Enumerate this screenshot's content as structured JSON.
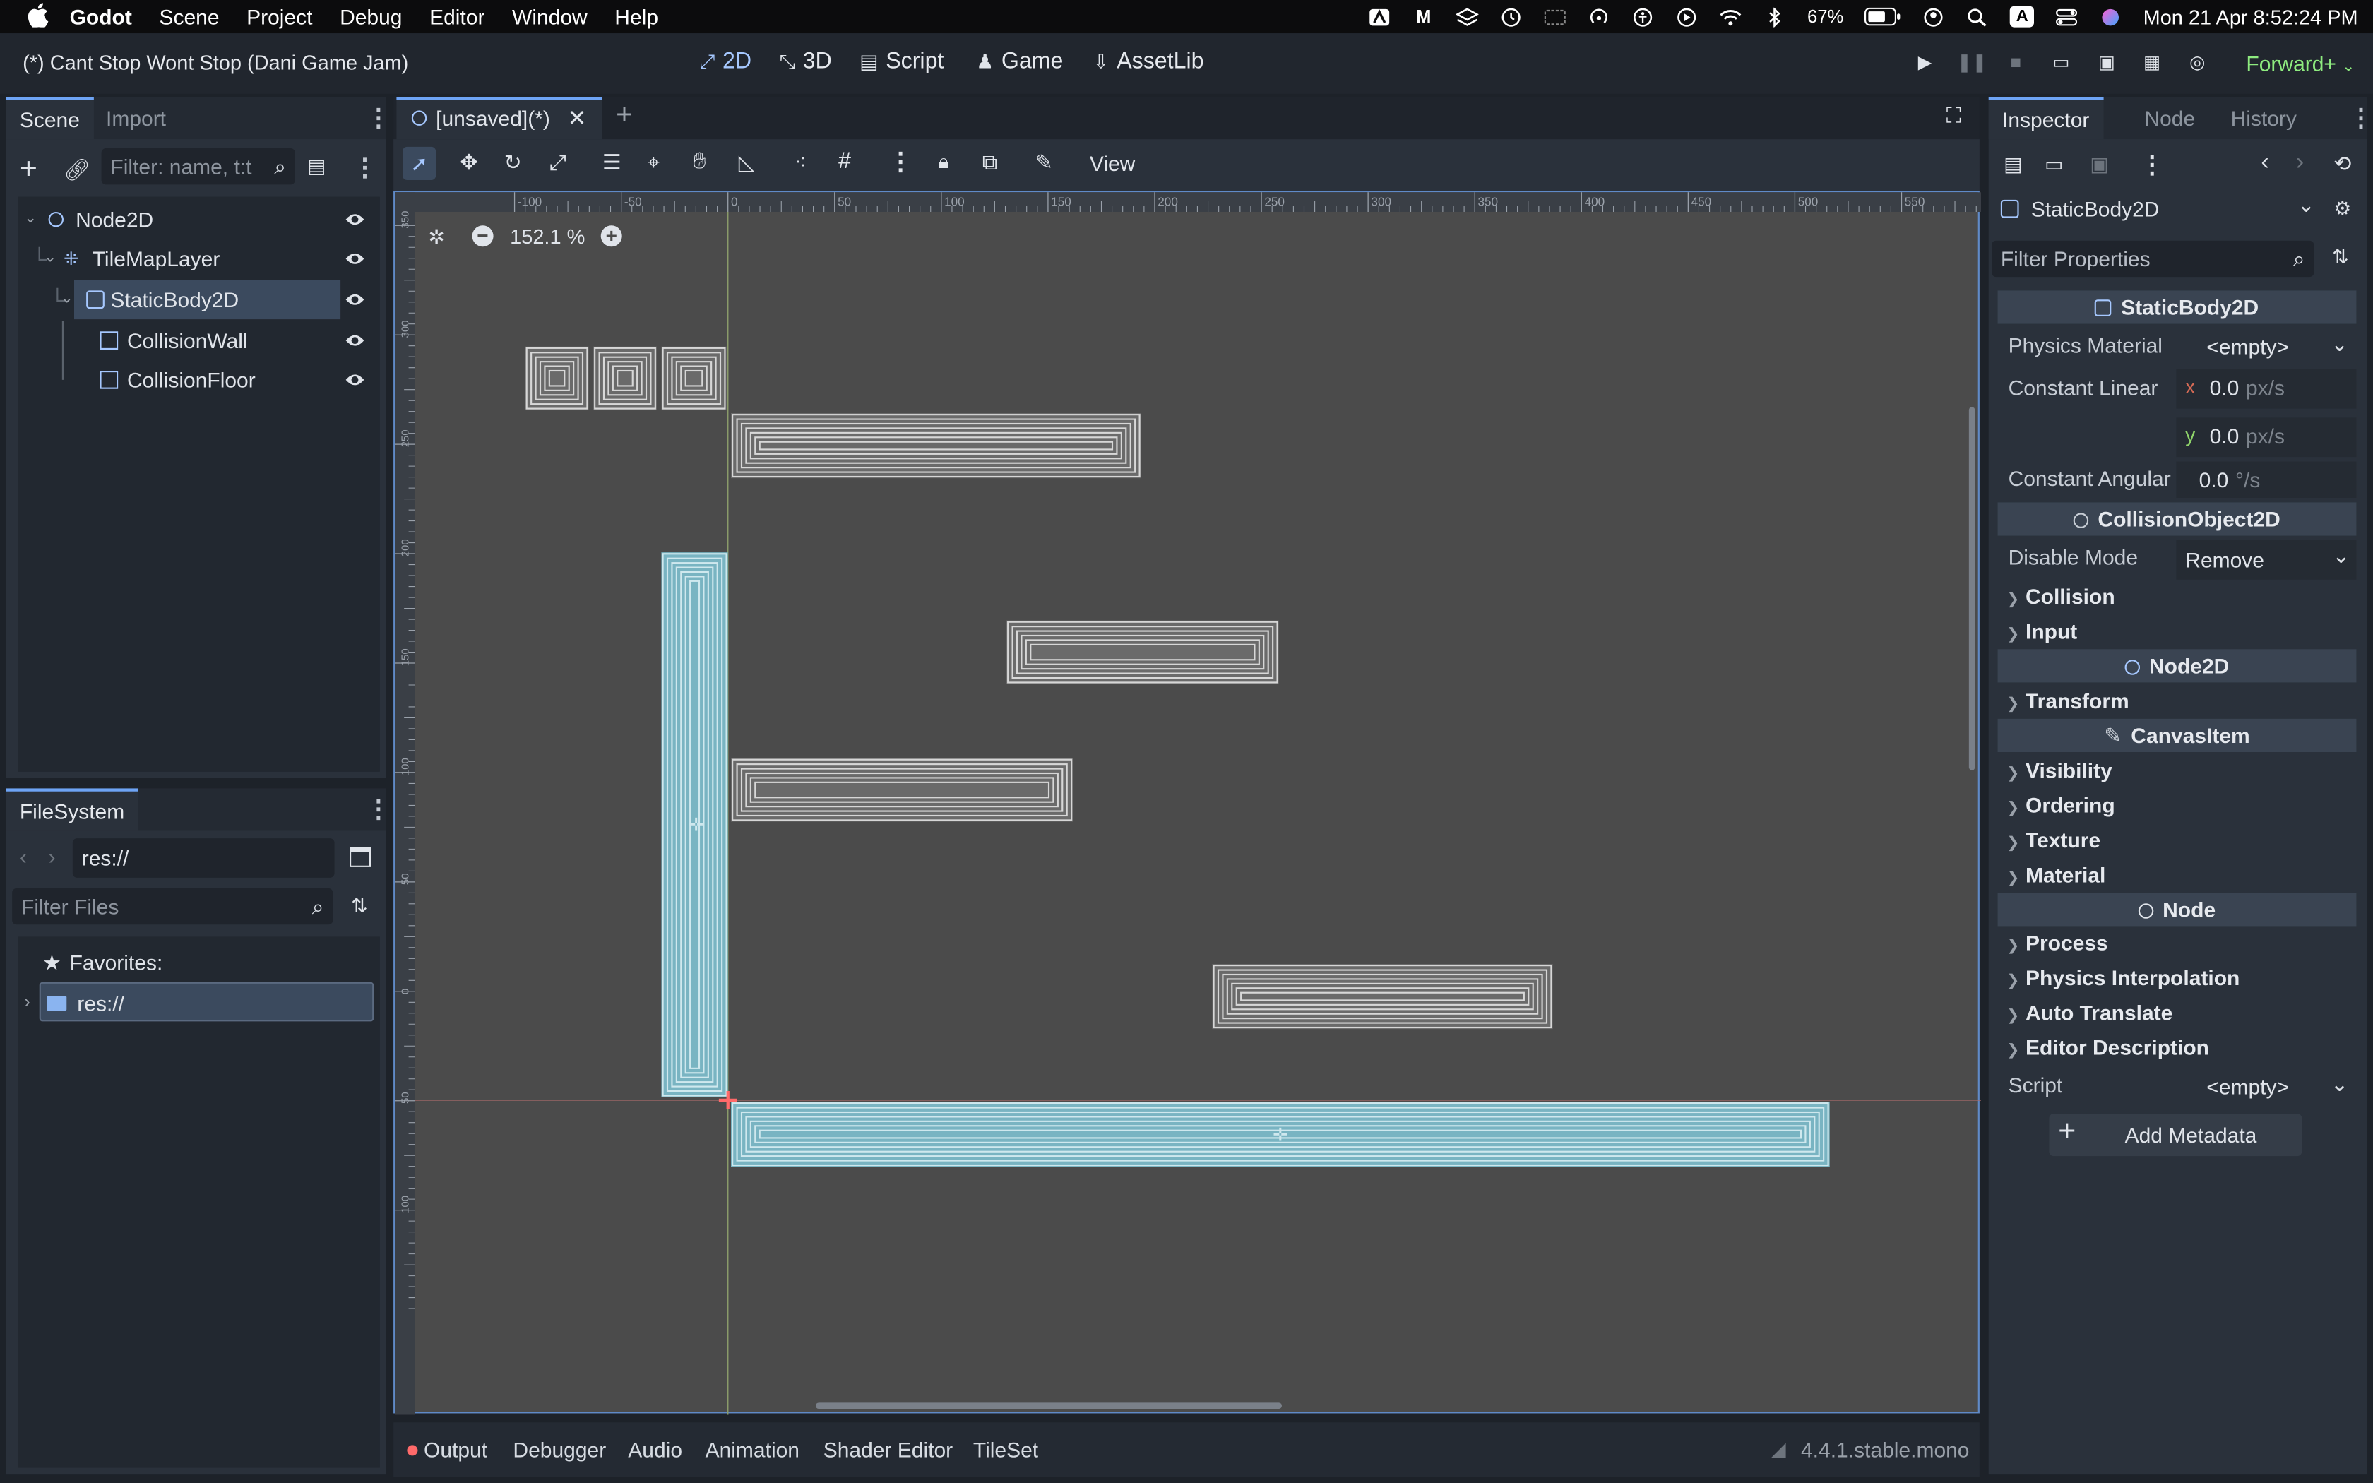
{
  "menubar": {
    "app": "Godot",
    "items": [
      "Scene",
      "Project",
      "Debug",
      "Editor",
      "Window",
      "Help"
    ],
    "battery": "67%",
    "input_source": "A",
    "datetime": "Mon 21 Apr  8:52:24 PM"
  },
  "title": "(*) Cant Stop Wont Stop (Dani Game Jam)",
  "workspaces": [
    "2D",
    "3D",
    "Script",
    "Game",
    "AssetLib"
  ],
  "active_workspace": "2D",
  "renderer": "Forward+",
  "scene_dock": {
    "tabs": [
      "Scene",
      "Import"
    ],
    "filter_placeholder": "Filter: name, t:t",
    "nodes": [
      {
        "name": "Node2D",
        "type_icon": "circle-node-icon"
      },
      {
        "name": "TileMapLayer",
        "type_icon": "tilemap-icon"
      },
      {
        "name": "StaticBody2D",
        "type_icon": "staticbody-icon",
        "selected": true
      },
      {
        "name": "CollisionWall",
        "type_icon": "collision-shape-icon"
      },
      {
        "name": "CollisionFloor",
        "type_icon": "collision-shape-icon"
      }
    ]
  },
  "filesystem_dock": {
    "tab": "FileSystem",
    "path": "res://",
    "filter_placeholder": "Filter Files",
    "favorites_label": "Favorites:",
    "root": "res://"
  },
  "editor": {
    "tab_label": "[unsaved](*)",
    "toolbar_view": "View",
    "zoom": "152.1 %",
    "ruler_x": [
      "-100",
      "-50",
      "0",
      "50",
      "100",
      "150",
      "200",
      "250",
      "300",
      "350",
      "400",
      "450",
      "500",
      "550"
    ],
    "ruler_y": [
      "350",
      "300",
      "250",
      "200",
      "150",
      "100",
      "50",
      "0",
      "50",
      "100"
    ]
  },
  "inspector": {
    "tabs": [
      "Inspector",
      "Node",
      "History"
    ],
    "node_type": "StaticBody2D",
    "filter_placeholder": "Filter Properties",
    "sections": {
      "staticbody": "StaticBody2D",
      "collisionobject": "CollisionObject2D",
      "node2d": "Node2D",
      "canvasitem": "CanvasItem",
      "node": "Node"
    },
    "physics_material_label": "Physics Material",
    "physics_material_value": "<empty>",
    "constant_linear_label": "Constant Linear",
    "linear_x": "0.0",
    "linear_y": "0.0",
    "linear_unit": "px/s",
    "axis_x": "x",
    "axis_y": "y",
    "constant_angular_label": "Constant Angular",
    "angular_value": "0.0",
    "angular_unit": "°/s",
    "disable_mode_label": "Disable Mode",
    "disable_mode_value": "Remove",
    "groups_collision": [
      "Collision",
      "Input"
    ],
    "groups_node2d": [
      "Transform"
    ],
    "groups_canvas": [
      "Visibility",
      "Ordering",
      "Texture",
      "Material"
    ],
    "groups_node": [
      "Process",
      "Physics Interpolation",
      "Auto Translate",
      "Editor Description"
    ],
    "script_label": "Script",
    "script_value": "<empty>",
    "add_metadata": "Add Metadata"
  },
  "bottom_panel": {
    "tabs": [
      "Output",
      "Debugger",
      "Audio",
      "Animation",
      "Shader Editor",
      "TileSet"
    ],
    "version": "4.4.1.stable.mono"
  },
  "colors": {
    "accent": "#6ea4f5",
    "renderer": "#8eeb7f",
    "selected_body": "#79b4c2"
  }
}
